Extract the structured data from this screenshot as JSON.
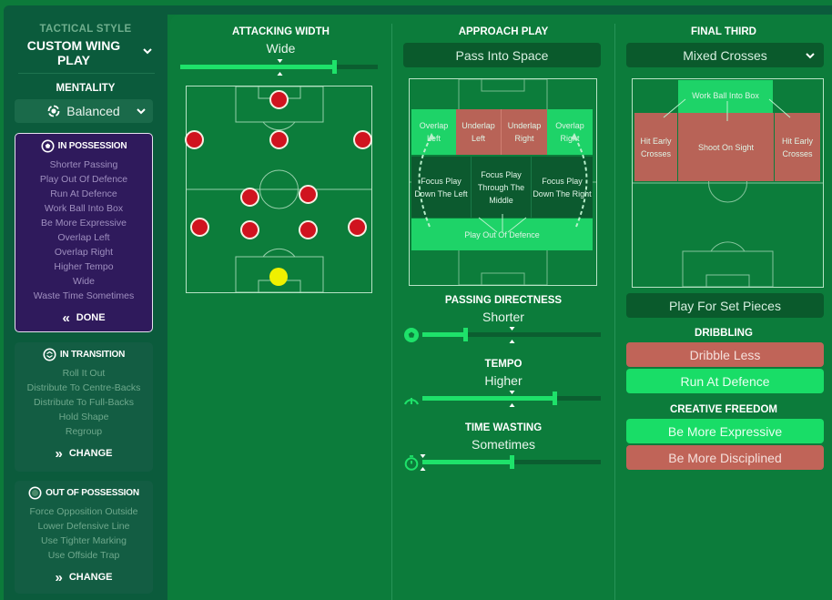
{
  "sidebar": {
    "tactical_style_label": "TACTICAL STYLE",
    "tactical_style_name": "CUSTOM WING PLAY",
    "mentality_label": "MENTALITY",
    "mentality_value": "Balanced",
    "in_possession": {
      "title": "IN POSSESSION",
      "items": [
        "Shorter Passing",
        "Play Out Of Defence",
        "Run At Defence",
        "Work Ball Into Box",
        "Be More Expressive",
        "Overlap Left",
        "Overlap Right",
        "Higher Tempo",
        "Wide",
        "Waste Time Sometimes"
      ],
      "action": "DONE"
    },
    "in_transition": {
      "title": "IN TRANSITION",
      "items": [
        "Roll It Out",
        "Distribute To Centre-Backs",
        "Distribute To Full-Backs",
        "Hold Shape",
        "Regroup"
      ],
      "action": "CHANGE"
    },
    "out_of_possession": {
      "title": "OUT OF POSSESSION",
      "items": [
        "Force Opposition Outside",
        "Lower Defensive Line",
        "Use Tighter Marking",
        "Use Offside Trap"
      ],
      "action": "CHANGE"
    }
  },
  "attacking_width": {
    "title": "ATTACKING WIDTH",
    "value": "Wide",
    "level": 0.78,
    "default": 0.5
  },
  "approach_play": {
    "title": "APPROACH PLAY",
    "selected": "Pass Into Space",
    "zones": {
      "overlap_left": "Overlap Left",
      "underlap_left": "Underlap Left",
      "underlap_right": "Underlap Right",
      "overlap_right": "Overlap Right",
      "focus_left": "Focus Play Down The Left",
      "focus_middle": "Focus Play Through The Middle",
      "focus_right": "Focus Play Down The Right",
      "play_out": "Play Out Of Defence"
    }
  },
  "passing_directness": {
    "title": "PASSING DIRECTNESS",
    "value": "Shorter",
    "level": 0.24,
    "default": 0.5
  },
  "tempo": {
    "title": "TEMPO",
    "value": "Higher",
    "level": 0.74,
    "default": 0.5
  },
  "time_wasting": {
    "title": "TIME WASTING",
    "value": "Sometimes",
    "level": 0.5,
    "default": 0.0
  },
  "final_third": {
    "title": "FINAL THIRD",
    "selected": "Mixed Crosses",
    "zones": {
      "work_ball": "Work Ball Into Box",
      "hit_early_left": "Hit Early Crosses",
      "shoot": "Shoot On Sight",
      "hit_early_right": "Hit Early Crosses"
    },
    "set_pieces": "Play For Set Pieces"
  },
  "dribbling": {
    "title": "DRIBBLING",
    "options": [
      "Dribble Less",
      "Run At Defence"
    ]
  },
  "creative_freedom": {
    "title": "CREATIVE FREEDOM",
    "options": [
      "Be More Expressive",
      "Be More Disciplined"
    ]
  },
  "colors": {
    "accent_green": "#1ee26a",
    "deselected_red": "#c06458",
    "possession_purple": "#2f1a5c",
    "player_red": "#d0131f",
    "goalkeeper_yellow": "#f0f000"
  }
}
